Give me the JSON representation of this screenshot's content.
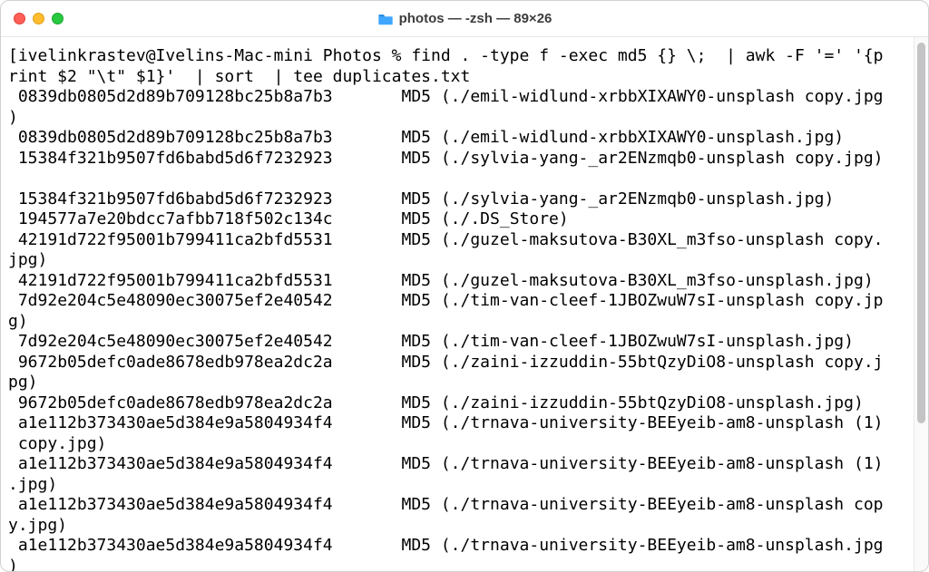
{
  "titlebar": {
    "folder_icon_name": "folder-icon",
    "title": "photos — -zsh — 89×26"
  },
  "prompt": {
    "left_bracket": "[",
    "user_host": "ivelinkrastev@Ivelins-Mac-mini",
    "cwd": "Photos",
    "sep": "%",
    "command": "find . -type f -exec md5 {} \\;  | awk -F '=' '{print $2 \"\\t\" $1}'  | sort  | tee duplicates.txt"
  },
  "lines": [
    " 0839db0805d2d89b709128bc25b8a7b3       MD5 (./emil-widlund-xrbbXIXAWY0-unsplash copy.jpg)",
    " 0839db0805d2d89b709128bc25b8a7b3       MD5 (./emil-widlund-xrbbXIXAWY0-unsplash.jpg)",
    " 15384f321b9507fd6babd5d6f7232923       MD5 (./sylvia-yang-_ar2ENzmqb0-unsplash copy.jpg)",
    "",
    " 15384f321b9507fd6babd5d6f7232923       MD5 (./sylvia-yang-_ar2ENzmqb0-unsplash.jpg)",
    " 194577a7e20bdcc7afbb718f502c134c       MD5 (./.DS_Store)",
    " 42191d722f95001b799411ca2bfd5531       MD5 (./guzel-maksutova-B30XL_m3fso-unsplash copy.jpg)",
    " 42191d722f95001b799411ca2bfd5531       MD5 (./guzel-maksutova-B30XL_m3fso-unsplash.jpg)",
    " 7d92e204c5e48090ec30075ef2e40542       MD5 (./tim-van-cleef-1JBOZwuW7sI-unsplash copy.jpg)",
    " 7d92e204c5e48090ec30075ef2e40542       MD5 (./tim-van-cleef-1JBOZwuW7sI-unsplash.jpg)",
    " 9672b05defc0ade8678edb978ea2dc2a       MD5 (./zaini-izzuddin-55btQzyDiO8-unsplash copy.jpg)",
    " 9672b05defc0ade8678edb978ea2dc2a       MD5 (./zaini-izzuddin-55btQzyDiO8-unsplash.jpg)",
    " a1e112b373430ae5d384e9a5804934f4       MD5 (./trnava-university-BEEyeib-am8-unsplash (1) copy.jpg)",
    " a1e112b373430ae5d384e9a5804934f4       MD5 (./trnava-university-BEEyeib-am8-unsplash (1).jpg)",
    " a1e112b373430ae5d384e9a5804934f4       MD5 (./trnava-university-BEEyeib-am8-unsplash copy.jpg)",
    " a1e112b373430ae5d384e9a5804934f4       MD5 (./trnava-university-BEEyeib-am8-unsplash.jpg)"
  ],
  "colors": {
    "close": "#ff5f57",
    "min": "#febc2e",
    "max": "#28c840"
  }
}
